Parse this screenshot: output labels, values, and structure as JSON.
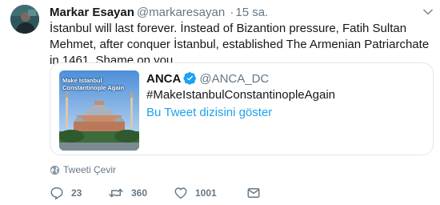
{
  "tweet": {
    "author_name": "Markar Esayan",
    "author_handle": "@markaresayan",
    "separator": "·",
    "time": "15 sa.",
    "text": "İstanbul will last forever. İnstead of Bizantion pressure, Fatih Sultan Mehmet, after conquer İstanbul, established The Armenian Patriarchate in 1461. Shame on you."
  },
  "quoted": {
    "name": "ANCA",
    "verified": true,
    "handle": "@ANCA_DC",
    "hashtag": "#MakeIstanbulConstantinopleAgain",
    "image_caption": "Make Istanbul Constantinople Again",
    "thread_link": "Bu Tweet dizisini göster"
  },
  "translate_label": "Tweeti Çevir",
  "actions": {
    "replies": "23",
    "retweets": "360",
    "likes": "1001"
  },
  "colors": {
    "text": "#14171a",
    "secondary": "#657786",
    "link": "#1da1f2",
    "border": "#e1e8ed"
  },
  "icons": [
    "chevron-down-icon",
    "verified-badge-icon",
    "globe-icon",
    "reply-icon",
    "retweet-icon",
    "like-icon",
    "direct-message-icon"
  ]
}
